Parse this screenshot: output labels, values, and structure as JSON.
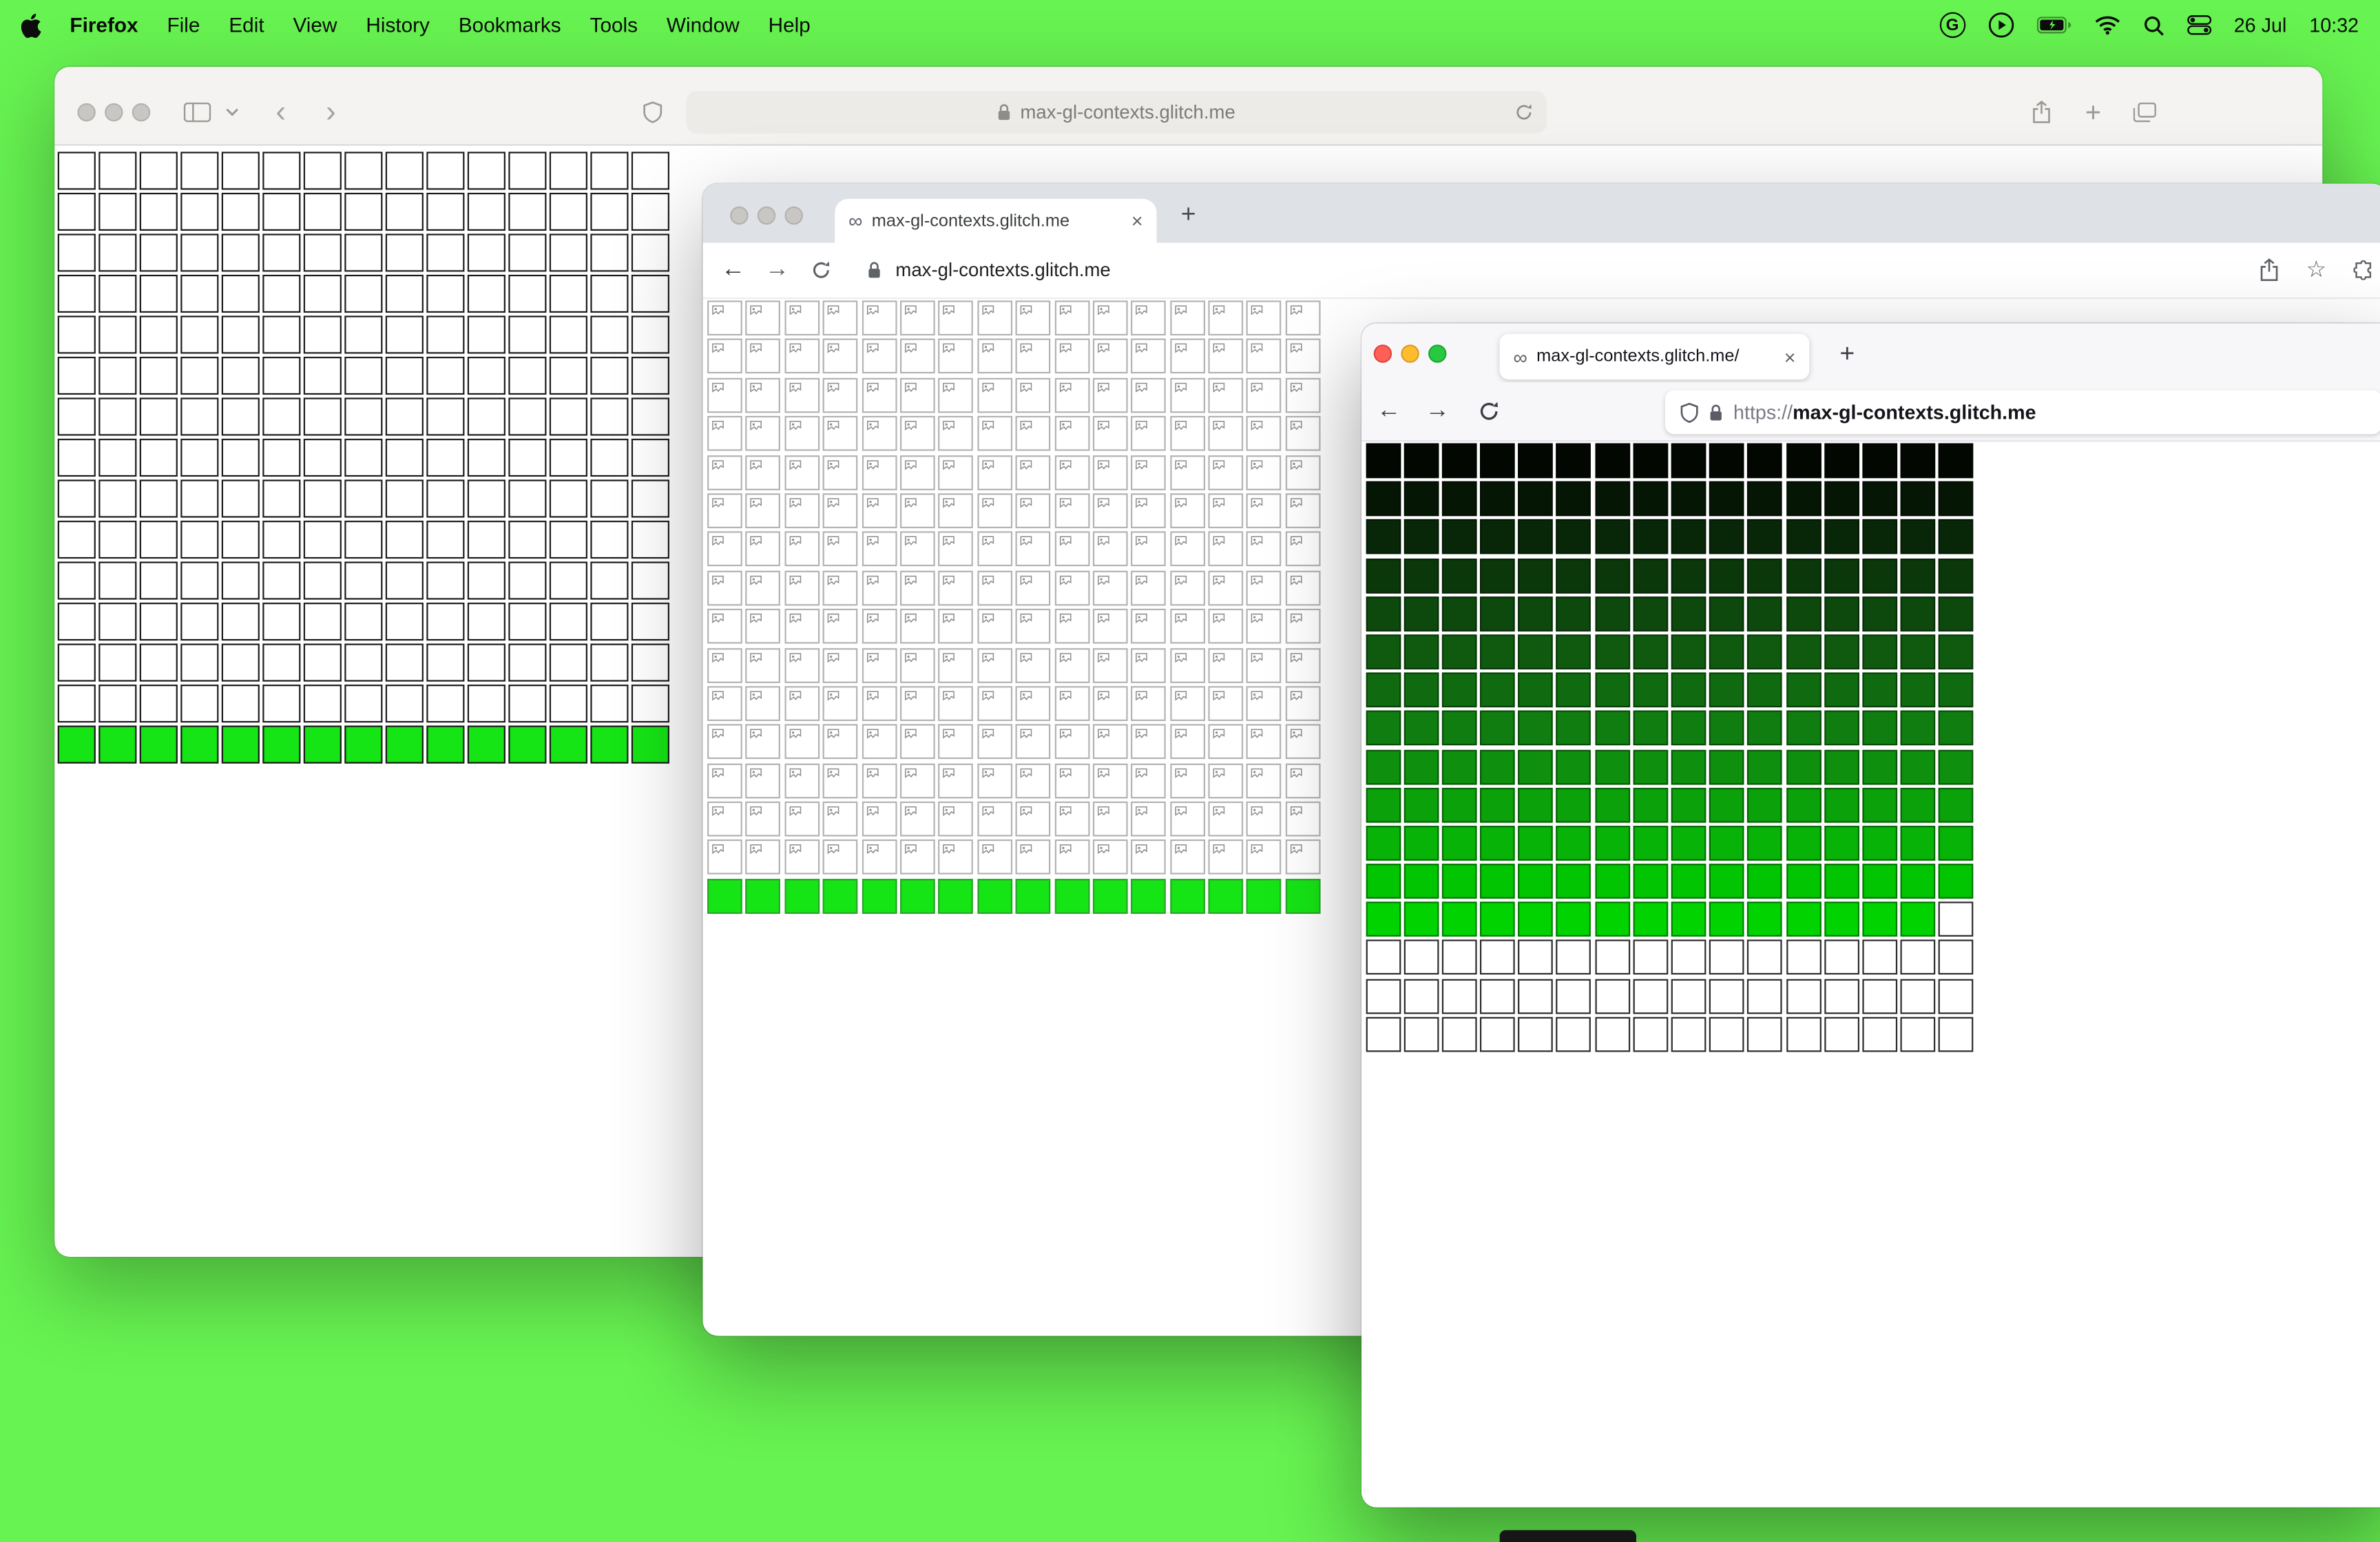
{
  "desktop": {
    "background": "#67f351",
    "status_date": "26 Jul",
    "status_time": "10:32"
  },
  "menubar": {
    "app_name": "Firefox",
    "menus": [
      "File",
      "Edit",
      "View",
      "History",
      "Bookmarks",
      "Tools",
      "Window",
      "Help"
    ]
  },
  "glyphs": {
    "infinity": "∞",
    "close": "×",
    "plus": "+",
    "back_chevron": "‹",
    "forward_chevron": "›",
    "back_arrow": "←",
    "forward_arrow": "→",
    "star": "☆",
    "grammarly": "G"
  },
  "safari_window": {
    "address": "max-gl-contexts.glitch.me"
  },
  "chrome_window": {
    "tab_title": "max-gl-contexts.glitch.me",
    "address": "max-gl-contexts.glitch.me"
  },
  "firefox_window": {
    "tab_title": "max-gl-contexts.glitch.me/",
    "address_scheme": "https://",
    "address_host": "max-gl-contexts.glitch.me"
  },
  "grids": {
    "safari": {
      "cols": 15,
      "cell": 25,
      "gap": 2,
      "empty_border": "#1c1c1c",
      "green": "#15e415",
      "green_border": "#1c1c1c",
      "rows": [
        "empty",
        "empty",
        "empty",
        "empty",
        "empty",
        "empty",
        "empty",
        "empty",
        "empty",
        "empty",
        "empty",
        "empty",
        "empty",
        "empty",
        "green"
      ]
    },
    "chrome": {
      "cols": 16,
      "cell": 23,
      "gap": 2.4,
      "broken_border": "#b3b3b3",
      "green": "#15e415",
      "green_border": "#2aa52a",
      "rows": [
        "broken",
        "broken",
        "broken",
        "broken",
        "broken",
        "broken",
        "broken",
        "broken",
        "broken",
        "broken",
        "broken",
        "broken",
        "broken",
        "broken",
        "broken",
        "green"
      ]
    },
    "firefox": {
      "cols": 16,
      "cell": 23,
      "gap": 2.2,
      "empty_border": "#2b2b2b",
      "rows": [
        {
          "color": "#020702"
        },
        {
          "color": "#051605"
        },
        {
          "color": "#082708"
        },
        {
          "color": "#0b380b"
        },
        {
          "color": "#0d490d"
        },
        {
          "color": "#0f5a0f"
        },
        {
          "color": "#106b10"
        },
        {
          "color": "#107d10"
        },
        {
          "color": "#0e8f0e"
        },
        {
          "color": "#0aa10a"
        },
        {
          "color": "#06b306"
        },
        {
          "color": "#02c502"
        },
        {
          "color": "#00d300",
          "white_tail": 1
        },
        "empty",
        "empty",
        "empty"
      ]
    }
  }
}
